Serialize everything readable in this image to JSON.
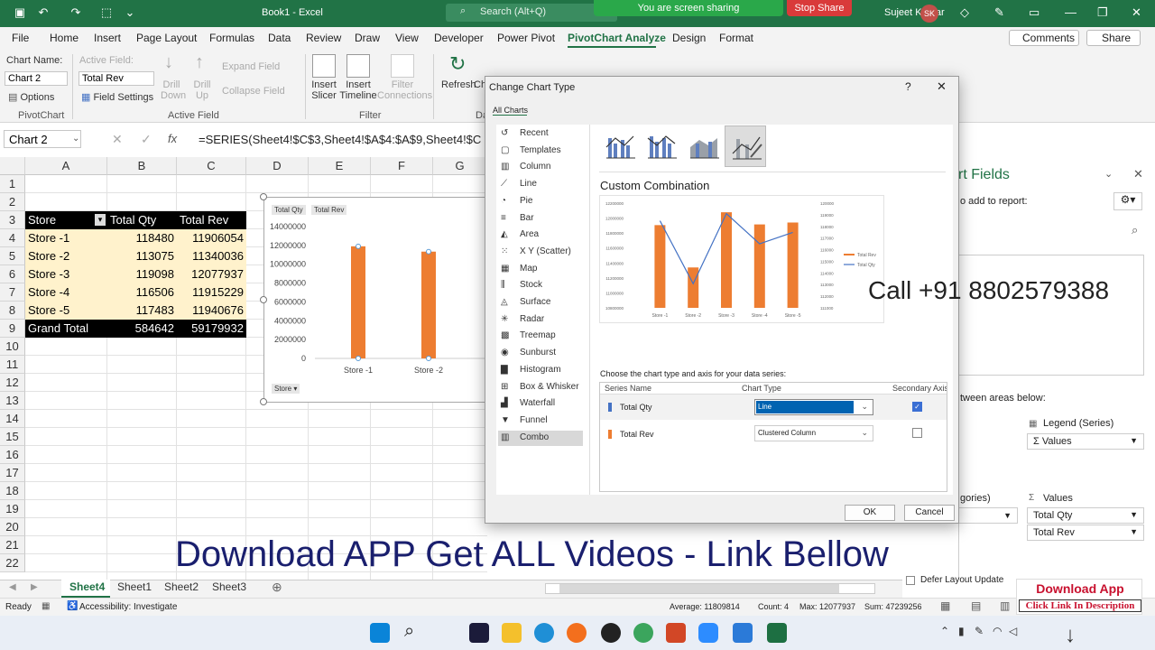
{
  "window": {
    "doc_title": "Book1 - Excel",
    "search_placeholder": "Search (Alt+Q)",
    "sharing_banner": "You are screen sharing",
    "stop_sharing": "Stop Share",
    "user_name": "Sujeet Kumar",
    "user_initials": "SK"
  },
  "ribbon_tabs": [
    "File",
    "Home",
    "Insert",
    "Page Layout",
    "Formulas",
    "Data",
    "Review",
    "Draw",
    "View",
    "Developer",
    "Power Pivot",
    "PivotChart Analyze",
    "Design",
    "Format"
  ],
  "ribbon_right": {
    "comments": "Comments",
    "share": "Share"
  },
  "ribbon": {
    "chart_name_label": "Chart Name:",
    "chart_name_value": "Chart 2",
    "options": "Options",
    "pivotchart_group": "PivotChart",
    "active_field_label": "Active Field:",
    "active_field_value": "Total Rev",
    "field_settings": "Field Settings",
    "drill_down": "Drill Down",
    "drill_up": "Drill Up",
    "expand_field": "Expand Field",
    "collapse_field": "Collapse Field",
    "active_field_group": "Active Field",
    "insert_slicer": "Insert Slicer",
    "insert_timeline": "Insert Timeline",
    "filter_connections": "Filter Connections",
    "filter_group": "Filter",
    "refresh": "Refresh",
    "change": "Ch",
    "data_group": "Da"
  },
  "formula_bar": {
    "name_box": "Chart 2",
    "formula": "=SERIES(Sheet4!$C$3,Sheet4!$A$4:$A$9,Sheet4!$C"
  },
  "columns": [
    "A",
    "B",
    "C",
    "D",
    "E",
    "F",
    "G"
  ],
  "rows": [
    "1",
    "2",
    "3",
    "4",
    "5",
    "6",
    "7",
    "8",
    "9",
    "10",
    "11",
    "12",
    "13",
    "14",
    "15",
    "16",
    "17",
    "18",
    "19",
    "20",
    "21",
    "22"
  ],
  "table": {
    "headers": [
      "Store",
      "Total Qty",
      "Total Rev"
    ],
    "rows": [
      [
        "Store -1",
        "118480",
        "11906054"
      ],
      [
        "Store -2",
        "113075",
        "11340036"
      ],
      [
        "Store -3",
        "119098",
        "12077937"
      ],
      [
        "Store -4",
        "116506",
        "11915229"
      ],
      [
        "Store -5",
        "117483",
        "11940676"
      ]
    ],
    "total": [
      "Grand Total",
      "584642",
      "59179932"
    ]
  },
  "sheet_chart": {
    "field_buttons": [
      "Total Qty",
      "Total Rev"
    ],
    "axis_button": "Store",
    "y_ticks": [
      "14000000",
      "12000000",
      "10000000",
      "8000000",
      "6000000",
      "4000000",
      "2000000",
      "0"
    ],
    "categories": [
      "Store -1",
      "Store -2",
      "Stor"
    ]
  },
  "chart_data": {
    "type": "bar",
    "categories": [
      "Store -1",
      "Store -2"
    ],
    "series": [
      {
        "name": "Total Rev",
        "values": [
          11906054,
          11340036
        ]
      }
    ],
    "ylim": [
      0,
      14000000
    ],
    "color": "#ed7d31"
  },
  "dialog": {
    "title": "Change Chart Type",
    "help": "?",
    "close": "✕",
    "tab": "All Charts",
    "categories": [
      "Recent",
      "Templates",
      "Column",
      "Line",
      "Pie",
      "Bar",
      "Area",
      "X Y (Scatter)",
      "Map",
      "Stock",
      "Surface",
      "Radar",
      "Treemap",
      "Sunburst",
      "Histogram",
      "Box & Whisker",
      "Waterfall",
      "Funnel",
      "Combo"
    ],
    "selected_category": "Combo",
    "combo_title": "Custom Combination",
    "instruction": "Choose the chart type and axis for your data series:",
    "table_headers": [
      "Series Name",
      "Chart Type",
      "Secondary Axis"
    ],
    "series": [
      {
        "name": "Total Qty",
        "chart_type": "Line",
        "secondary": true,
        "color": "#4472c4"
      },
      {
        "name": "Total Rev",
        "chart_type": "Clustered Column",
        "secondary": false,
        "color": "#ed7d31"
      }
    ],
    "ok": "OK",
    "cancel": "Cancel",
    "preview": {
      "categories": [
        "Store -1",
        "Store -2",
        "Store -3",
        "Store -4",
        "Store -5"
      ],
      "left_ticks": [
        "12200000",
        "12000000",
        "11800000",
        "11600000",
        "11400000",
        "11200000",
        "11000000",
        "10800000"
      ],
      "right_ticks": [
        "120000",
        "119000",
        "118000",
        "117000",
        "116000",
        "115000",
        "114000",
        "113000",
        "112000",
        "111000"
      ],
      "legend": [
        "Total Rev",
        "Total Qty"
      ],
      "rev_values": [
        11906054,
        11340036,
        12077937,
        11915229,
        11940676
      ],
      "qty_values": [
        118480,
        113075,
        119098,
        116506,
        117483
      ]
    }
  },
  "field_panel": {
    "title": "rt Fields",
    "add_hint": "o add to report:",
    "areas_hint": "tween areas below:",
    "legend_label": "Legend (Series)",
    "legend_value": "Σ Values",
    "categories_label": "gories)",
    "values_label": "Values",
    "values": [
      "Total Qty",
      "Total Rev"
    ],
    "defer": "Defer Layout Update"
  },
  "sheets": [
    "Sheet4",
    "Sheet1",
    "Sheet2",
    "Sheet3"
  ],
  "active_sheet": "Sheet4",
  "status": {
    "ready": "Ready",
    "accessibility": "Accessibility: Investigate",
    "average": "Average: 11809814",
    "count": "Count: 4",
    "max": "Max: 12077937",
    "sum": "Sum: 47239256"
  },
  "overlay": {
    "call": "Call +91 8802579388",
    "promo": "Download APP Get ALL Videos -  Link Bellow",
    "download_app": "Download App",
    "click_link": "Click Link In Description"
  }
}
